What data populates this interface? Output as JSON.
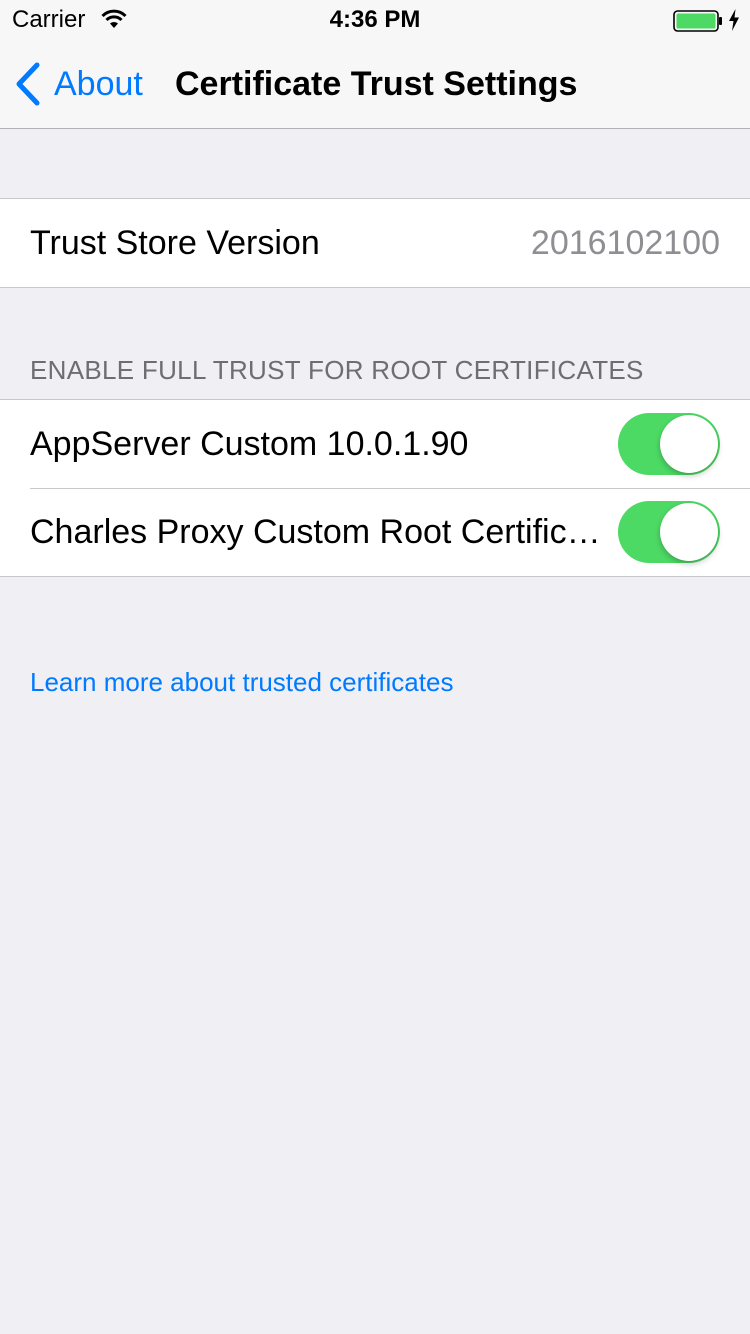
{
  "status_bar": {
    "carrier": "Carrier",
    "time": "4:36 PM",
    "battery_color": "#4cd964"
  },
  "nav": {
    "back_label": "About",
    "title": "Certificate Trust Settings"
  },
  "trust_store": {
    "label": "Trust Store Version",
    "value": "2016102100"
  },
  "root_certificates": {
    "header": "ENABLE FULL TRUST FOR ROOT CERTIFICATES",
    "items": [
      {
        "label": "AppServer Custom 10.0.1.90",
        "enabled": true
      },
      {
        "label": "Charles Proxy Custom Root Certificate",
        "enabled": true
      }
    ]
  },
  "learn_more": {
    "text": "Learn more about trusted certificates"
  },
  "colors": {
    "accent": "#007aff",
    "toggle_on": "#4cd964",
    "background": "#efeff4"
  },
  "icons": [
    "wifi-icon",
    "battery-icon",
    "charging-icon",
    "back-chevron-icon"
  ]
}
